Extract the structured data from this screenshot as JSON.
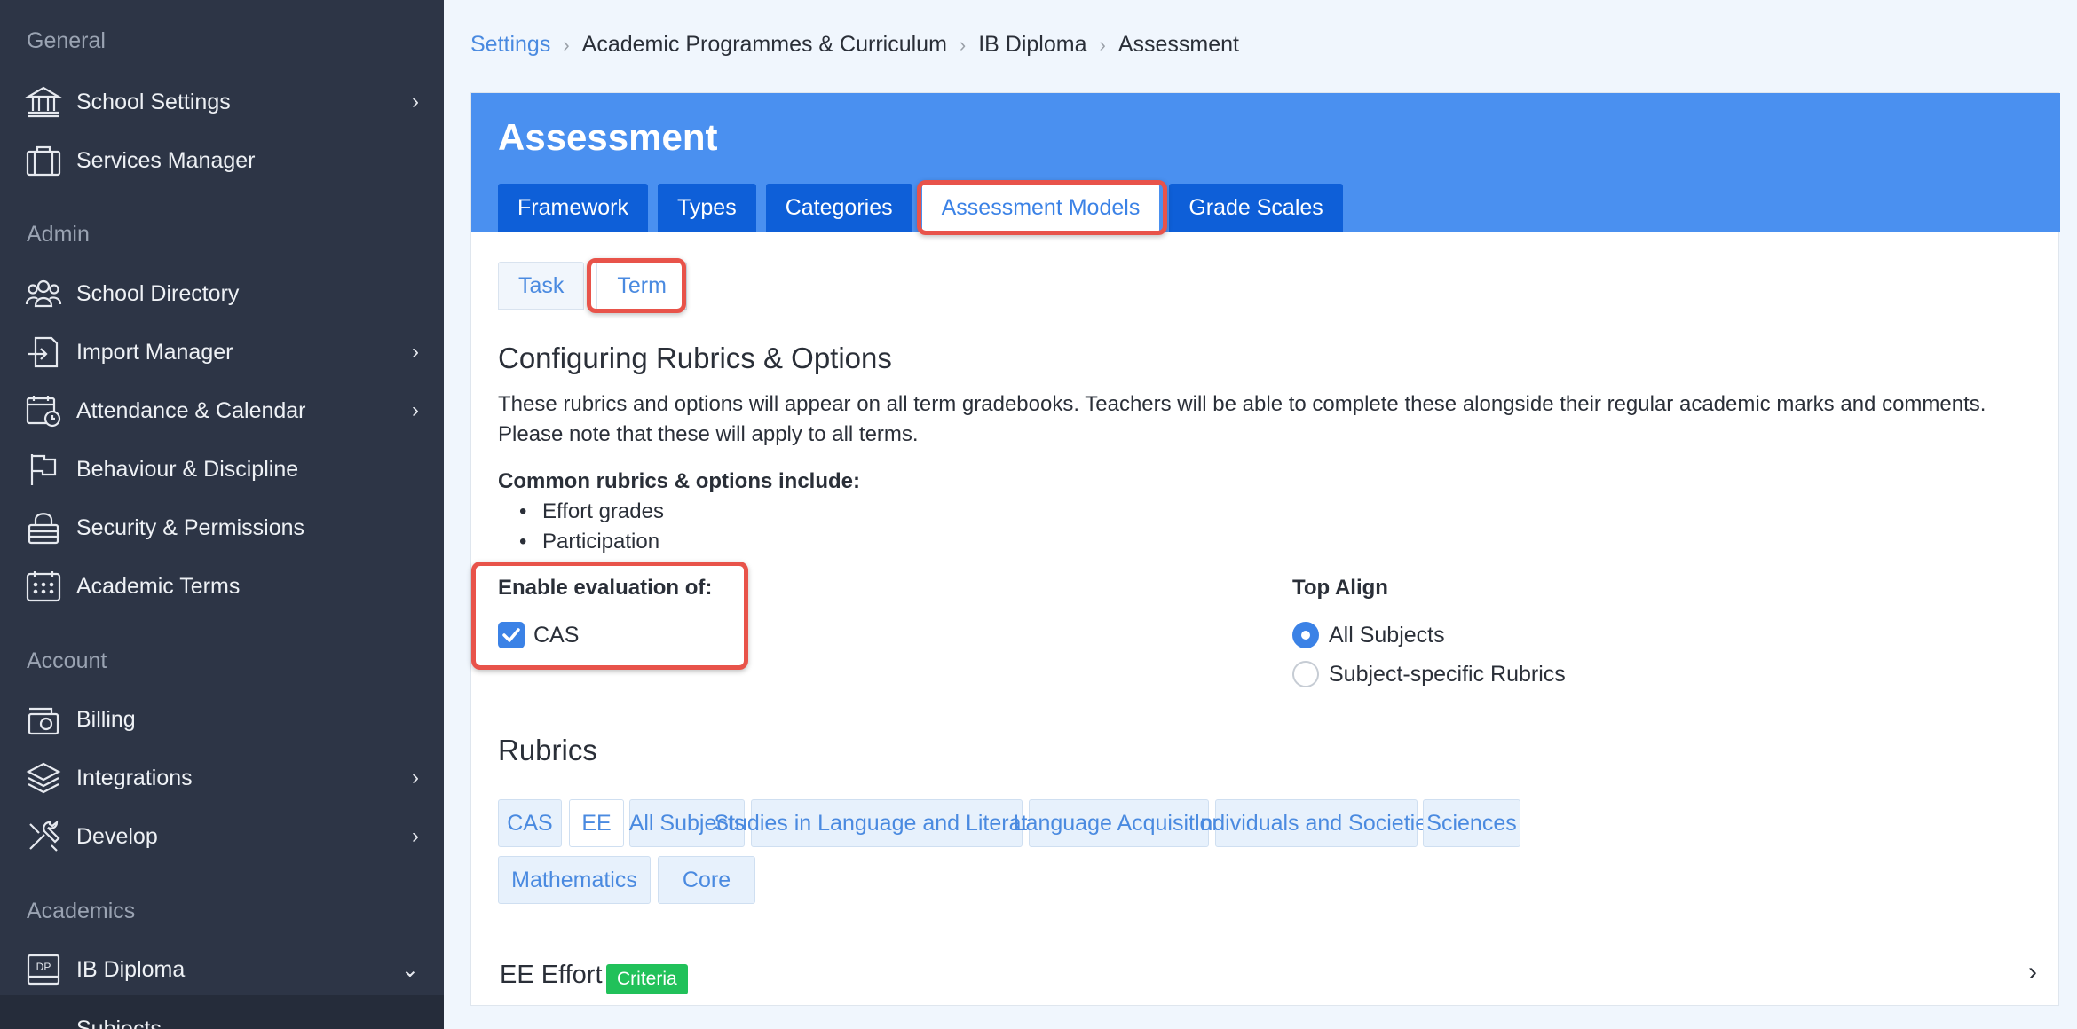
{
  "sidebar": {
    "sections": {
      "general": "General",
      "admin": "Admin",
      "account": "Account",
      "academics": "Academics"
    },
    "items": [
      {
        "label": "School Settings",
        "icon": "bank-icon",
        "chevron": "›"
      },
      {
        "label": "Services Manager",
        "icon": "briefcase-icon"
      },
      {
        "label": "School Directory",
        "icon": "users-icon"
      },
      {
        "label": "Import Manager",
        "icon": "import-icon",
        "chevron": "›"
      },
      {
        "label": "Attendance & Calendar",
        "icon": "calendar-clock-icon",
        "chevron": "›"
      },
      {
        "label": "Behaviour & Discipline",
        "icon": "flag-icon"
      },
      {
        "label": "Security & Permissions",
        "icon": "lock-icon"
      },
      {
        "label": "Academic Terms",
        "icon": "calendar-grid-icon"
      },
      {
        "label": "Billing",
        "icon": "wallet-icon"
      },
      {
        "label": "Integrations",
        "icon": "layers-icon",
        "chevron": "›"
      },
      {
        "label": "Develop",
        "icon": "tools-icon",
        "chevron": "›"
      },
      {
        "label": "IB Diploma",
        "icon": "dp-icon",
        "icon_text": "DP",
        "chevron": "⌄"
      }
    ],
    "sub_item": "Subjects"
  },
  "breadcrumb": {
    "link": "Settings",
    "items": [
      "Academic Programmes & Curriculum",
      "IB Diploma",
      "Assessment"
    ],
    "separator": "›"
  },
  "page": {
    "title": "Assessment",
    "tabs": [
      "Framework",
      "Types",
      "Categories",
      "Assessment Models",
      "Grade Scales"
    ],
    "active_tab": "Assessment Models",
    "subtabs": [
      "Task",
      "Term"
    ],
    "active_subtab": "Term"
  },
  "content": {
    "heading": "Configuring Rubrics & Options",
    "description": "These rubrics and options will appear on all term gradebooks. Teachers will be able to complete these alongside their regular academic marks and comments. Please note that these will apply to all terms.",
    "common_label": "Common rubrics & options include:",
    "common_items": [
      "Effort grades",
      "Participation"
    ],
    "enable_label": "Enable evaluation of:",
    "enable_option": "CAS",
    "enable_checked": true,
    "align_label": "Top Align",
    "align_options": [
      "All Subjects",
      "Subject-specific Rubrics"
    ],
    "align_selected": "All Subjects"
  },
  "rubrics": {
    "heading": "Rubrics",
    "tabs": [
      "CAS",
      "EE",
      "All Subjects",
      "Studies in Language and Literature",
      "Language Acquisition",
      "Individuals and Societies",
      "Sciences",
      "Mathematics",
      "Core"
    ],
    "active_tab": "EE",
    "item_title": "EE Effort",
    "item_badge": "Criteria",
    "item_chevron": "›"
  },
  "colors": {
    "sidebar_bg": "#2d3546",
    "header_blue": "#4a90f0",
    "tab_blue": "#0e5fd8",
    "highlight_red": "#e8534a",
    "badge_green": "#21c15a",
    "link_blue": "#4a8ae0"
  }
}
